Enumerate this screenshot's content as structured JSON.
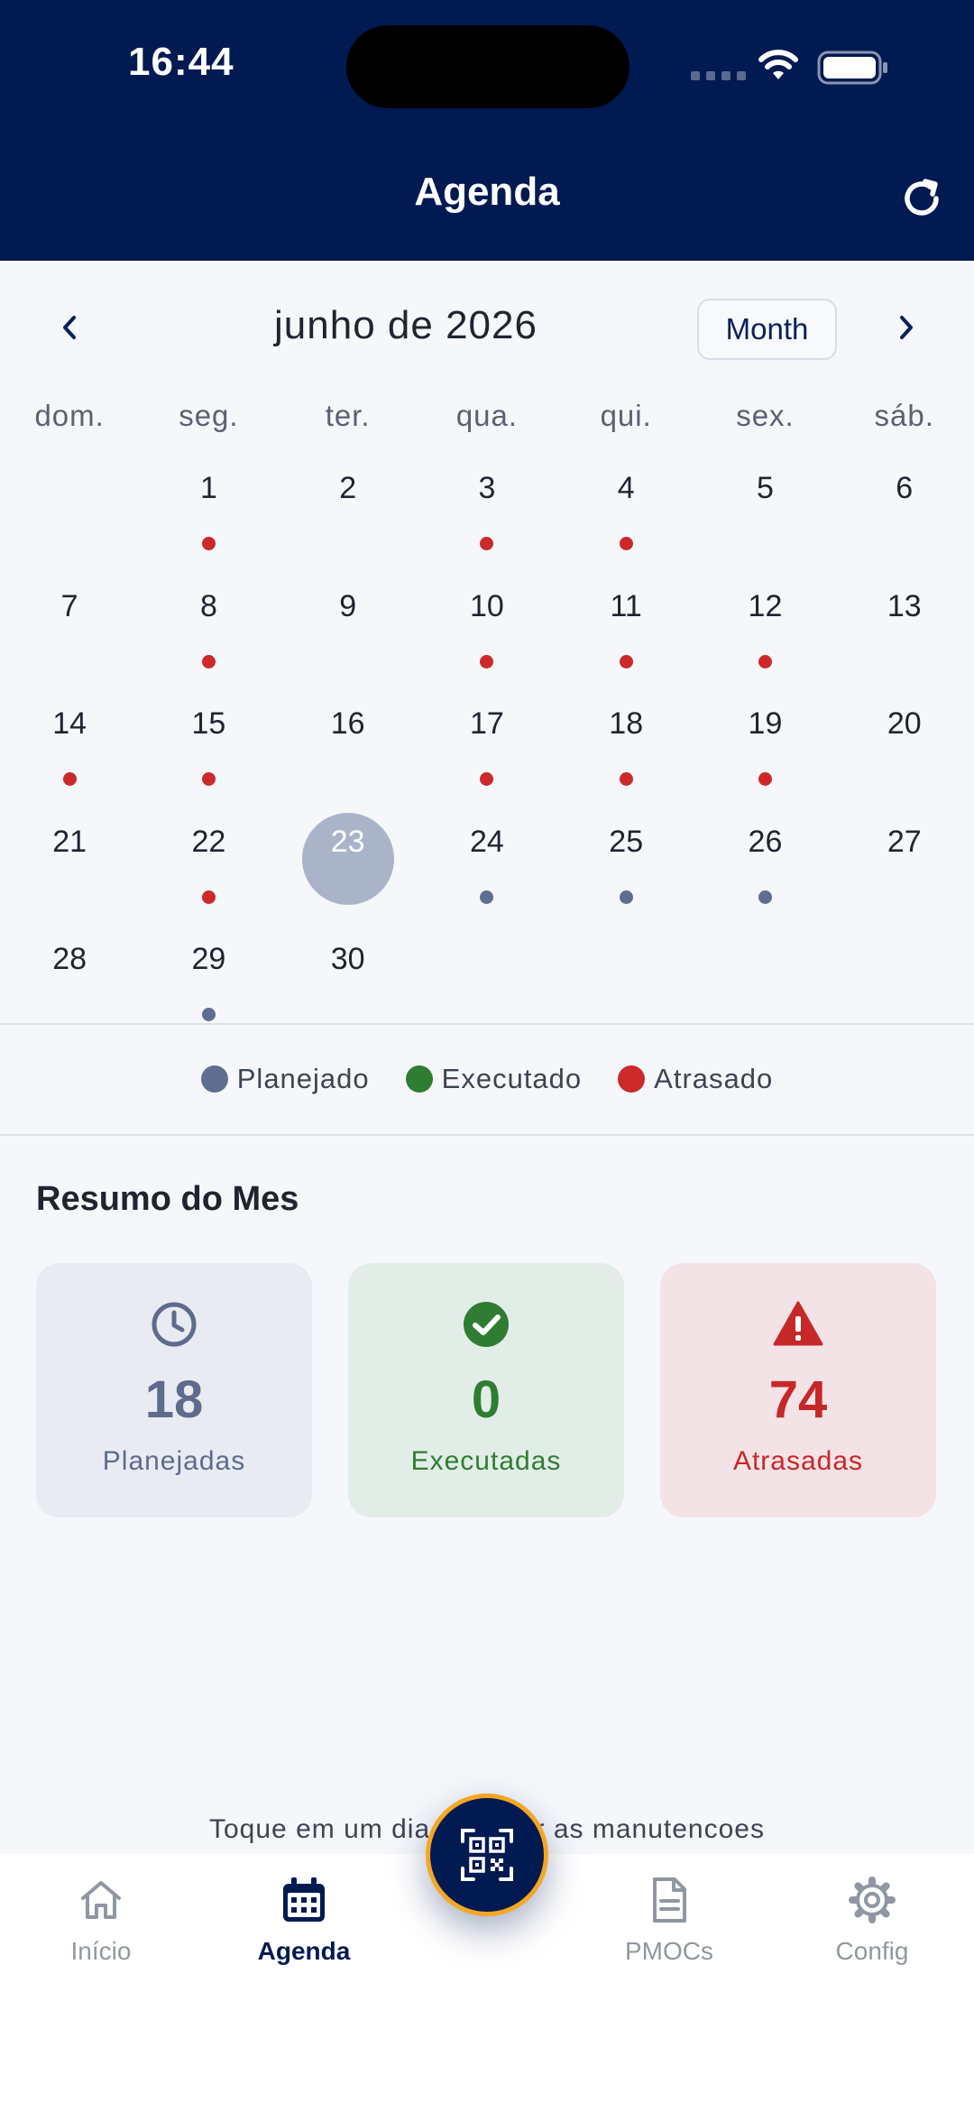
{
  "status_bar": {
    "time": "16:44"
  },
  "header": {
    "title": "Agenda"
  },
  "calendar": {
    "month_title": "junho de 2026",
    "view_button": "Month",
    "weekdays": [
      "dom.",
      "seg.",
      "ter.",
      "qua.",
      "qui.",
      "sex.",
      "sáb."
    ],
    "days": [
      {
        "n": "1",
        "status": "late"
      },
      {
        "n": "2",
        "status": ""
      },
      {
        "n": "3",
        "status": "late"
      },
      {
        "n": "4",
        "status": "late"
      },
      {
        "n": "5",
        "status": ""
      },
      {
        "n": "6",
        "status": ""
      },
      {
        "n": "7",
        "status": ""
      },
      {
        "n": "8",
        "status": "late"
      },
      {
        "n": "9",
        "status": ""
      },
      {
        "n": "10",
        "status": "late"
      },
      {
        "n": "11",
        "status": "late"
      },
      {
        "n": "12",
        "status": "late"
      },
      {
        "n": "13",
        "status": ""
      },
      {
        "n": "14",
        "status": "late"
      },
      {
        "n": "15",
        "status": "late"
      },
      {
        "n": "16",
        "status": ""
      },
      {
        "n": "17",
        "status": "late"
      },
      {
        "n": "18",
        "status": "late"
      },
      {
        "n": "19",
        "status": "late"
      },
      {
        "n": "20",
        "status": ""
      },
      {
        "n": "21",
        "status": ""
      },
      {
        "n": "22",
        "status": "late"
      },
      {
        "n": "23",
        "status": "",
        "selected": true
      },
      {
        "n": "24",
        "status": "planned"
      },
      {
        "n": "25",
        "status": "planned"
      },
      {
        "n": "26",
        "status": "planned"
      },
      {
        "n": "27",
        "status": ""
      },
      {
        "n": "28",
        "status": ""
      },
      {
        "n": "29",
        "status": "planned"
      },
      {
        "n": "30",
        "status": ""
      }
    ],
    "first_weekday_offset": 1,
    "selected_day": "23"
  },
  "legend": [
    {
      "label": "Planejado",
      "color": "#5f6e90"
    },
    {
      "label": "Executado",
      "color": "#2e7d32"
    },
    {
      "label": "Atrasado",
      "color": "#cc2a2a"
    }
  ],
  "summary": {
    "title": "Resumo do Mes",
    "cards": [
      {
        "value": "18",
        "label": "Planejadas",
        "icon": "clock-icon"
      },
      {
        "value": "0",
        "label": "Executadas",
        "icon": "check-circle-icon"
      },
      {
        "value": "74",
        "label": "Atrasadas",
        "icon": "warning-icon"
      }
    ]
  },
  "hint": "Toque em um dia para ver as manutencoes",
  "bottom_nav": {
    "items": [
      {
        "label": "Início",
        "icon": "home-icon"
      },
      {
        "label": "Agenda",
        "icon": "calendar-icon",
        "active": true
      },
      {
        "label": "PMOCs",
        "icon": "document-icon"
      },
      {
        "label": "Config",
        "icon": "gear-icon"
      }
    ],
    "fab_icon": "qr-code-scan-icon"
  },
  "colors": {
    "brand": "#011a52",
    "accent": "#f5a623",
    "late": "#cc2a2a",
    "planned": "#5f6e90",
    "executed": "#2e7d32"
  }
}
